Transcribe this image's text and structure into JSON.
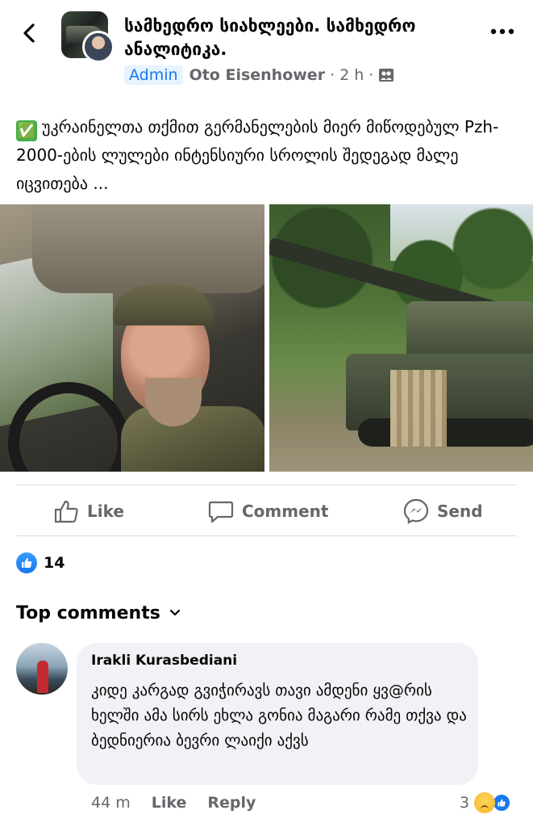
{
  "header": {
    "page_name": "სამხედრო სიახლეები. სამხედრო ანალიტიკა.",
    "badge": "Admin",
    "author": "Oto Eisenhower",
    "separator": "·",
    "time": "2 h",
    "audience_icon": "group-audience-icon",
    "back_icon": "back-chevron-icon",
    "more_icon": "more-dots-icon"
  },
  "post": {
    "emoji": "✅",
    "text": "უკრაინელთა თქმით გერმანელების მიერ მიწოდებულ Pzh-2000-ების ლულები ინტენსიური სროლის შედეგად მალე იცვითება ..."
  },
  "media": {
    "left_photo": "soldier-in-car-video",
    "right_photo": "pzh-2000-howitzer-photo",
    "mute_icon": "speaker-muted-icon"
  },
  "actions": {
    "like": "Like",
    "comment": "Comment",
    "send": "Send"
  },
  "reactions": {
    "count": "14"
  },
  "comments": {
    "sort_label": "Top comments",
    "items": [
      {
        "author": "Irakli Kurasbediani",
        "text": "კიდე კარგად გვიჭირავს თავი ამდენი ყვ@რის ხელში ამა სირს ეხლა გონია მაგარი რამე თქვა და ბედნიერია ბევრი ლაიქი აქვს",
        "time": "44 m",
        "like": "Like",
        "reply": "Reply",
        "reaction_count": "3"
      }
    ]
  },
  "colors": {
    "accent": "#1877f2",
    "secondary_text": "#65676b",
    "bubble": "#f0f2f5"
  }
}
